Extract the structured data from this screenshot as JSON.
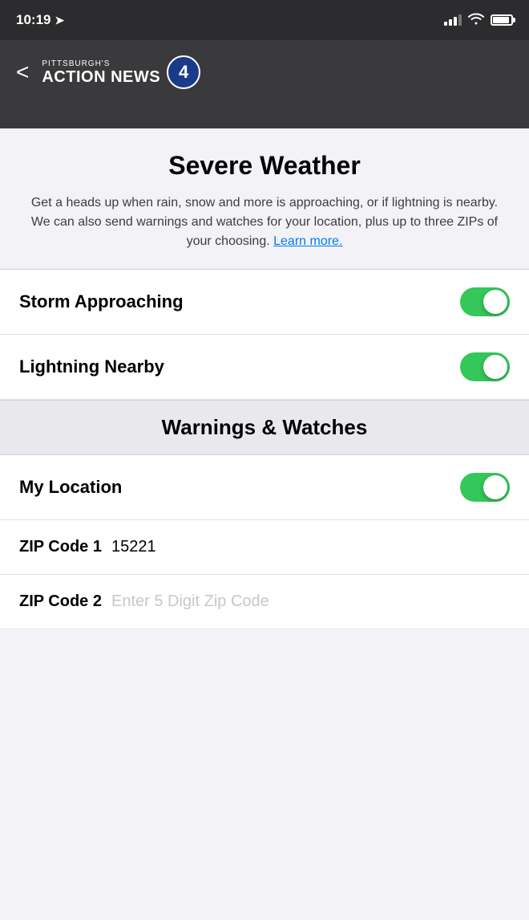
{
  "statusBar": {
    "time": "10:19",
    "locationArrow": "➤"
  },
  "navBar": {
    "backLabel": "<",
    "logoSubtitle": "PITTSBURGH'S",
    "logoTitle": "ACTION NEWS",
    "logoBadge": "4"
  },
  "page": {
    "title": "Severe Weather",
    "description": "Get a heads up when rain, snow and more is approaching, or if lightning is nearby. We can also send warnings and watches for your location, plus up to three ZIPs of your choosing.",
    "learnMoreLabel": "Learn more."
  },
  "toggles": [
    {
      "id": "storm-approaching",
      "label": "Storm Approaching",
      "enabled": true
    },
    {
      "id": "lightning-nearby",
      "label": "Lightning Nearby",
      "enabled": true
    }
  ],
  "warningsSection": {
    "title": "Warnings & Watches"
  },
  "watchToggles": [
    {
      "id": "my-location",
      "label": "My Location",
      "enabled": true
    }
  ],
  "zipCodes": [
    {
      "id": "zip1",
      "labelText": "ZIP Code 1",
      "value": "15221",
      "placeholder": ""
    },
    {
      "id": "zip2",
      "labelText": "ZIP Code 2",
      "value": "",
      "placeholder": "Enter 5 Digit Zip Code"
    }
  ],
  "colors": {
    "toggleOn": "#34c759",
    "link": "#007aff"
  }
}
